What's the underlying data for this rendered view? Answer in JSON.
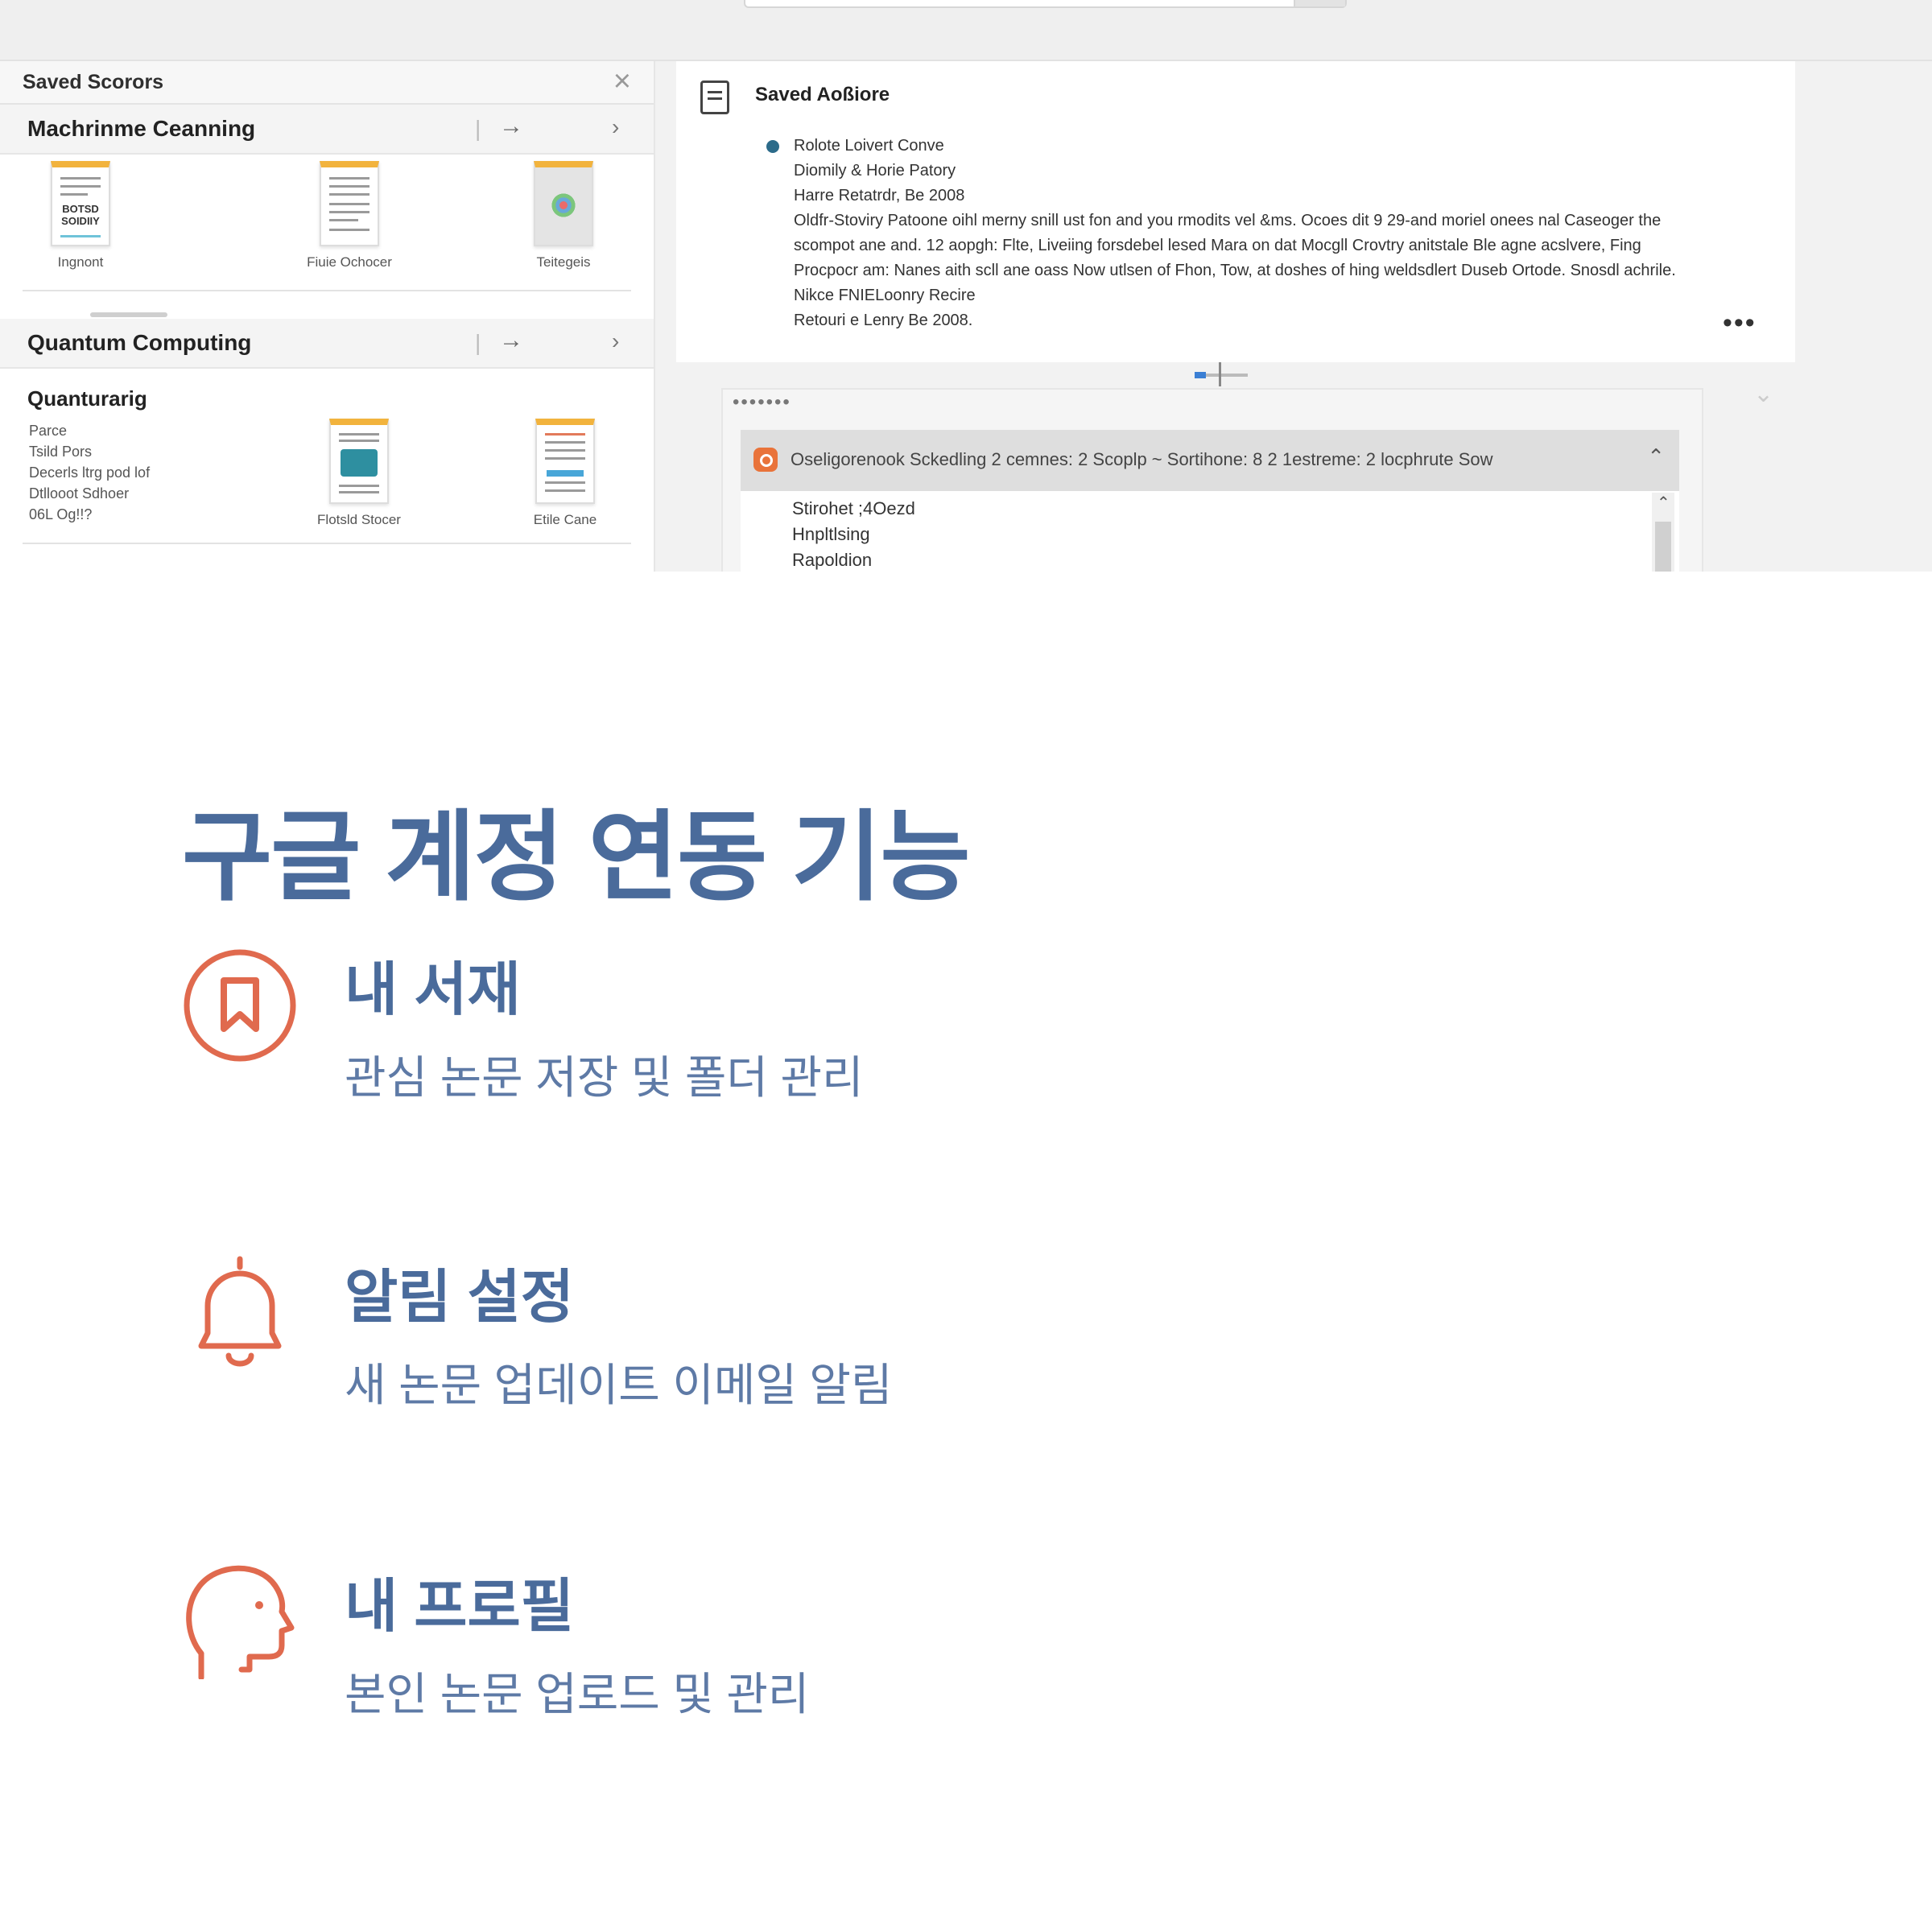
{
  "saved_panel": {
    "title": "Saved Scorors",
    "sections": [
      {
        "title": "Machrinme Ceanning",
        "docs": [
          {
            "label": "Ingnont",
            "cover_text": "BOTSD SOIDIIY"
          },
          {
            "label": "Fiuie Ochocer"
          },
          {
            "label": "Teitegeis"
          }
        ]
      },
      {
        "title": "Quantum Computing",
        "subheading": "Quanturarig",
        "lines": [
          "Parce",
          "Tsild Pors",
          "Decerls ltrg pod lof",
          "Dtllooot Sdhoer",
          "06L Og!!?"
        ],
        "docs": [
          {
            "label": "Flotsld Stocer"
          },
          {
            "label": "Etile Cane"
          }
        ]
      }
    ]
  },
  "article_card": {
    "title": "Saved Aoßiore",
    "lines": [
      "Rolote Loivert Conve",
      "Diomily & Horie Patory",
      "Harre Retatrdr, Be 2008",
      "Oldfr-Stoviry Patoone oihl merny snill ust fon and you rmodits vel &ms. Ocoes dit 9 29-and moriel onees nal Caseoger the",
      "scompot ane and. 12 aopgh: Flte, Liveiing forsdebel lesed Mara on dat Mocgll Crovtry anitstale Ble agne acslvere, Fing",
      "Procpocr am: Nanes aith scll ane oass Now utlsen of Fhon, Tow, at doshes of hing weldsdlert Duseb Ortode. Snosdl achrile.",
      "Nikce FNIELoonry Recire",
      "Retouri e Lenry Be 2008."
    ],
    "more": "•••"
  },
  "schedule_panel": {
    "dots": "•••••••",
    "accordion_text": "Oseligorenook Sckedling  2 cemnes:  2 Scoplp ~ Sortihone:  8  2 1estreme:  2 locphrute Sow",
    "items": [
      "Stirohet ;4Oezd",
      "Hnpltlsing",
      "Rapoldion"
    ]
  },
  "features": {
    "heading": "구글 계정 연동 기능",
    "items": [
      {
        "icon": "bookmark-icon",
        "title": "내 서재",
        "desc": "관심 논문 저장 및 폴더 관리"
      },
      {
        "icon": "bell-icon",
        "title": "알림 설정",
        "desc": "새 논문 업데이트 이메일 알림"
      },
      {
        "icon": "profile-head-icon",
        "title": "내 프로필",
        "desc": "본인 논문 업로드 및 관리"
      }
    ],
    "colors": {
      "heading": "#4a6b9b",
      "icon": "#e06a4e",
      "desc": "#5e7aa6"
    }
  }
}
